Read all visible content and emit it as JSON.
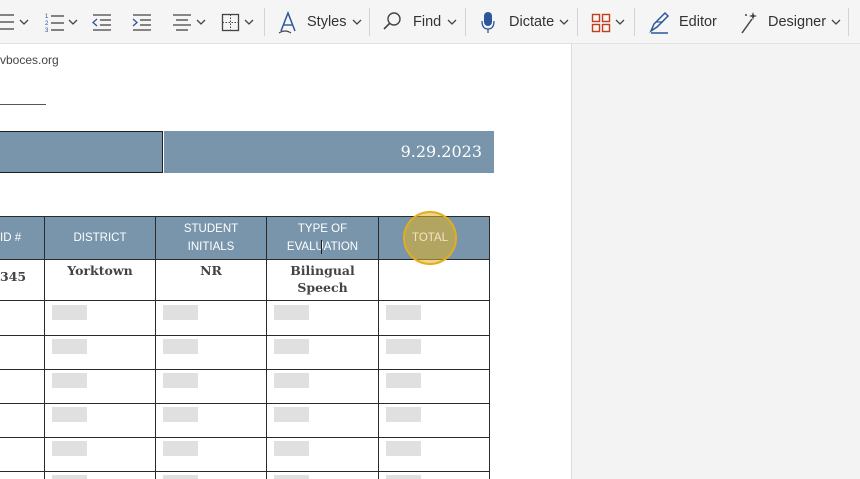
{
  "toolbar": {
    "styles_label": "Styles",
    "find_label": "Find",
    "dictate_label": "Dictate",
    "editor_label": "Editor",
    "designer_label": "Designer",
    "accent_blue": "#2b579a",
    "accent_orange": "#c43e1c"
  },
  "document": {
    "email_fragment": "vboces.org",
    "banner_date": "9.29.2023",
    "table": {
      "headers": [
        {
          "line1": "ID #",
          "line2": ""
        },
        {
          "line1": "DISTRICT",
          "line2": ""
        },
        {
          "line1": "STUDENT",
          "line2": "INITIALS"
        },
        {
          "line1": "TYPE OF",
          "line2": "EVALUATION"
        },
        {
          "line1": "TOTAL",
          "line2": ""
        }
      ],
      "first_row": {
        "id": "345",
        "district": "Yorktown",
        "initials": "NR",
        "evaluation_line1": "Bilingual",
        "evaluation_line2": "Speech",
        "total": ""
      }
    },
    "header_color": "#7895ab"
  }
}
